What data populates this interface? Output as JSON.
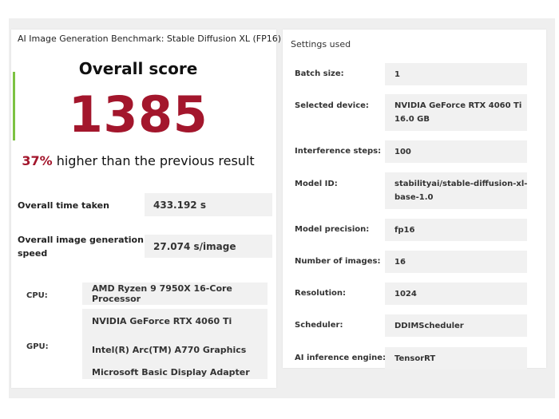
{
  "benchmark": {
    "title": "AI Image Generation Benchmark: Stable Diffusion XL (FP16)",
    "score_heading": "Overall score",
    "score_value": "1385",
    "compare_percent": "37%",
    "compare_text": "higher than the previous result",
    "accent_color": "#7cc242",
    "score_color": "#a3162c"
  },
  "stats": {
    "time_label": "Overall time taken",
    "time_value": "433.192 s",
    "speed_label_line1": "Overall image generation",
    "speed_label_line2": "speed",
    "speed_value": "27.074 s/image"
  },
  "hardware": {
    "cpu_label": "CPU:",
    "cpu_value": "AMD Ryzen 9 7950X 16-Core Processor",
    "gpu_label": "GPU:",
    "gpu_values": [
      "NVIDIA GeForce RTX 4060 Ti",
      "Intel(R) Arc(TM) A770 Graphics",
      "Microsoft Basic Display Adapter"
    ]
  },
  "settings": {
    "title": "Settings used",
    "rows": [
      {
        "label": "Batch size:",
        "value_lines": [
          "1"
        ]
      },
      {
        "label": "Selected device:",
        "value_lines": [
          "NVIDIA GeForce RTX 4060 Ti",
          "16.0 GB"
        ]
      },
      {
        "label": "Interference steps:",
        "value_lines": [
          "100"
        ]
      },
      {
        "label": "Model ID:",
        "value_lines": [
          "stabilityai/stable-diffusion-xl-",
          "base-1.0"
        ]
      },
      {
        "label": "Model precision:",
        "value_lines": [
          "fp16"
        ]
      },
      {
        "label": "Number of images:",
        "value_lines": [
          "16"
        ]
      },
      {
        "label": "Resolution:",
        "value_lines": [
          "1024"
        ]
      },
      {
        "label": "Scheduler:",
        "value_lines": [
          "DDIMScheduler"
        ]
      },
      {
        "label": "AI inference engine:",
        "value_lines": [
          "TensorRT"
        ]
      }
    ]
  }
}
